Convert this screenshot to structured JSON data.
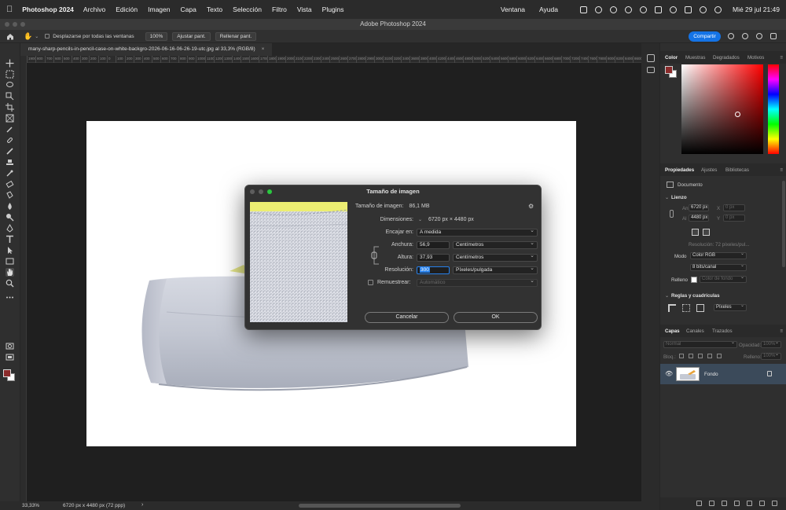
{
  "menubar": {
    "app_name": "Photoshop 2024",
    "menus": [
      "Archivo",
      "Edición",
      "Imagen",
      "Capa",
      "Texto",
      "Selección",
      "Filtro",
      "Vista",
      "Plugins"
    ],
    "right_menus": [
      "Ventana",
      "Ayuda"
    ],
    "datetime": "Mié 29 jul 21:49"
  },
  "window": {
    "title": "Adobe Photoshop 2024"
  },
  "optionsbar": {
    "scroll_all_label": "Desplazarse por todas las ventanas",
    "zoom_100": "100%",
    "fit_screen": "Ajustar pant.",
    "fill_screen": "Rellenar pant.",
    "share": "Compartir"
  },
  "document": {
    "tab_title": "many-sharp-pencils-in-pencil-case-on-white-backgro-2026-06-16-06-26-19-utc.jpg al 33,3% (RGB/8)",
    "close": "×"
  },
  "ruler": {
    "ticks": [
      "1900",
      "800",
      "700",
      "600",
      "500",
      "400",
      "300",
      "200",
      "100",
      "0",
      "100",
      "200",
      "300",
      "400",
      "500",
      "600",
      "700",
      "800",
      "900",
      "1000",
      "1100",
      "1200",
      "1300",
      "1400",
      "1500",
      "1600",
      "1700",
      "1800",
      "1900",
      "2000",
      "2100",
      "2200",
      "2300",
      "2400",
      "2500",
      "2600",
      "2700",
      "2800",
      "2900",
      "3000",
      "3100",
      "3200",
      "3400",
      "3600",
      "3800",
      "4000",
      "4200",
      "4400",
      "4600",
      "4800",
      "5000",
      "5200",
      "5400",
      "5600",
      "5800",
      "6000",
      "6200",
      "6400",
      "6600",
      "6800",
      "7000",
      "7200",
      "7400",
      "7600",
      "7800",
      "8000",
      "8200",
      "8400",
      "8600"
    ]
  },
  "statusbar": {
    "zoom": "33,33%",
    "info": "6720 px x 4480 px (72 ppp)",
    "arrow": "›"
  },
  "dialog": {
    "title": "Tamaño de imagen",
    "image_size_label": "Tamaño de imagen:",
    "image_size_value": "86,1 MB",
    "dimensions_label": "Dimensiones:",
    "dimensions_value": "6720 px × 4480 px",
    "fit_label": "Encajar en:",
    "fit_value": "A medida",
    "width_label": "Anchura:",
    "width_value": "56,9",
    "width_unit": "Centímetros",
    "height_label": "Altura:",
    "height_value": "37,93",
    "height_unit": "Centímetros",
    "resolution_label": "Resolución:",
    "resolution_value": "300",
    "resolution_unit": "Píxeles/pulgada",
    "resample_label": "Remuestrear:",
    "resample_value": "Automático",
    "cancel": "Cancelar",
    "ok": "OK"
  },
  "color_panel": {
    "tabs": [
      "Color",
      "Muestras",
      "Degradados",
      "Motivos"
    ],
    "foreground": "#8b2b2b",
    "background": "#ffffff"
  },
  "properties_panel": {
    "tabs": [
      "Propiedades",
      "Ajustes",
      "Bibliotecas"
    ],
    "type": "Documento",
    "canvas_section": "Lienzo",
    "w_label": "An",
    "w_value": "6720 px",
    "x_label": "X",
    "x_value": "0 px",
    "h_label": "Al",
    "h_value": "4480 px",
    "y_label": "Y",
    "y_value": "0 px",
    "resolution": "Resolución: 72 píxeles/pul...",
    "mode_label": "Modo",
    "mode_value": "Color RGB",
    "bits_value": "8 bits/canal",
    "fill_label": "Relleno",
    "fill_value": "Color de fondo",
    "rulers_section": "Reglas y cuadrículas",
    "units_value": "Píxeles"
  },
  "layers_panel": {
    "tabs": [
      "Capas",
      "Canales",
      "Trazados"
    ],
    "blend_mode": "Normal",
    "opacity_label": "Opacidad:",
    "opacity_value": "100%",
    "lock_label": "Bloq.:",
    "fill_label": "Relleno:",
    "fill_value": "100%",
    "layer_name": "Fondo"
  }
}
